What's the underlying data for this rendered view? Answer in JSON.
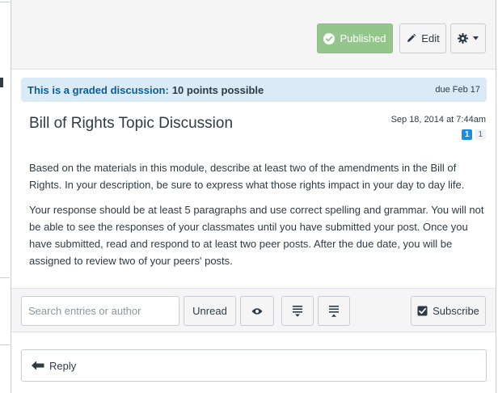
{
  "header": {
    "published_label": "Published",
    "edit_label": "Edit"
  },
  "graded": {
    "label": "This is a graded discussion:",
    "points": "10 points possible",
    "due": "due Feb 17"
  },
  "topic": {
    "title": "Bill of Rights Topic Discussion",
    "posted": "Sep 18, 2014 at 7:44am",
    "unread_count": "1",
    "total_count": "1"
  },
  "body": {
    "paragraphs": [
      "Based on the materials in this module, describe at least two of the amendments in the Bill of Rights. In your description, be sure to express what those rights impact in your day to day life.",
      "Your response should be at least 5 paragraphs and use correct spelling and grammar. You will not be able to see the responses of your classmates until you have submitted your post. Once you have submitted, read and respond to at least two peer posts. After the due date, you will be assigned to review two of your peers' posts."
    ]
  },
  "toolbar": {
    "search_placeholder": "Search entries or author",
    "unread_label": "Unread",
    "subscribe_label": "Subscribe"
  },
  "reply": {
    "label": "Reply"
  },
  "colors": {
    "published_green": "#94c58c",
    "banner_blue": "#d8ebf7",
    "link_blue": "#0b5d99",
    "badge_blue": "#1a8ce6"
  }
}
